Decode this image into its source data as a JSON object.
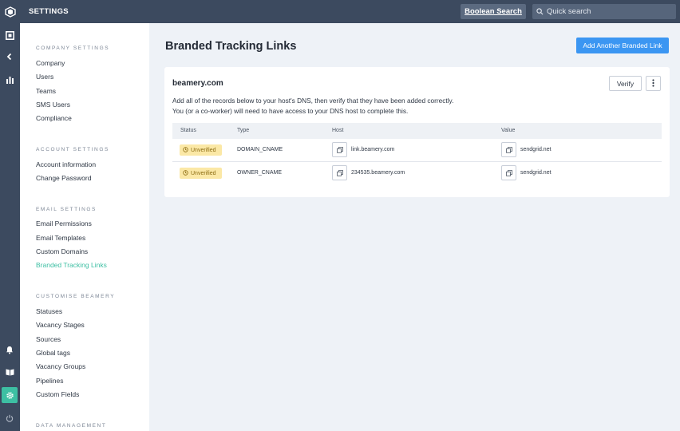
{
  "topbar": {
    "title": "SETTINGS",
    "boolean_search_label": "Boolean Search",
    "quick_search_placeholder": "Quick search"
  },
  "rail": {
    "top_icons": [
      "dashboard-icon",
      "back-arrow-icon",
      "reports-icon"
    ],
    "bottom_icons": [
      "bell-icon",
      "book-icon",
      "settings-gear-icon",
      "power-icon"
    ],
    "active_icon": "settings-gear-icon"
  },
  "nav": {
    "sections": [
      {
        "heading": "COMPANY SETTINGS",
        "items": [
          "Company",
          "Users",
          "Teams",
          "SMS Users",
          "Compliance"
        ]
      },
      {
        "heading": "ACCOUNT SETTINGS",
        "items": [
          "Account information",
          "Change Password"
        ]
      },
      {
        "heading": "EMAIL SETTINGS",
        "items": [
          "Email Permissions",
          "Email Templates",
          "Custom Domains",
          "Branded Tracking Links"
        ]
      },
      {
        "heading": "CUSTOMISE BEAMERY",
        "items": [
          "Statuses",
          "Vacancy Stages",
          "Sources",
          "Global tags",
          "Vacancy Groups",
          "Pipelines",
          "Custom Fields"
        ]
      },
      {
        "heading": "DATA MANAGEMENT",
        "items": []
      }
    ],
    "active_item": "Branded Tracking Links"
  },
  "main": {
    "title": "Branded Tracking Links",
    "add_button_label": "Add Another Branded Link",
    "card": {
      "domain": "beamery.com",
      "verify_label": "Verify",
      "instructions": [
        "Add all of the records below to your host's DNS, then verify that they have been added correctly.",
        "You (or a co-worker) will need to have access to your DNS host to complete this."
      ],
      "table": {
        "headers": [
          "Status",
          "Type",
          "Host",
          "Value"
        ],
        "rows": [
          {
            "status": "Unverified",
            "type": "DOMAIN_CNAME",
            "host": "link.beamery.com",
            "value": "sendgrid.net"
          },
          {
            "status": "Unverified",
            "type": "OWNER_CNAME",
            "host": "234535.beamery.com",
            "value": "sendgrid.net"
          }
        ]
      }
    }
  },
  "colors": {
    "topbar": "#3c4a5f",
    "accent": "#3dbfa3",
    "primary_button": "#3b96f2",
    "badge_bg": "#fbe8a6",
    "page_bg": "#eef2f7"
  }
}
